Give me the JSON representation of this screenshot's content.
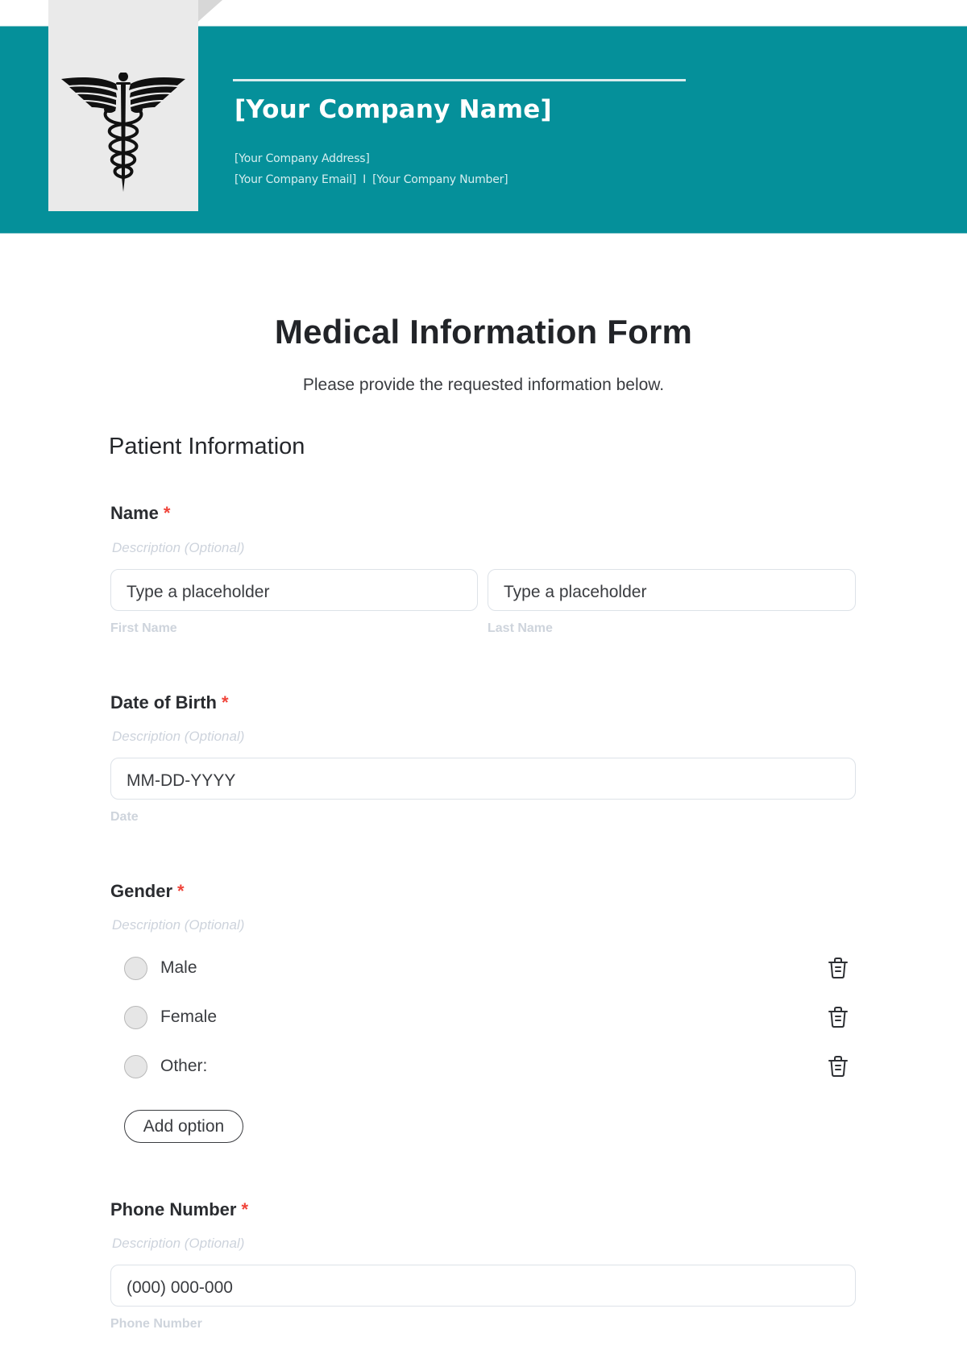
{
  "header": {
    "company_name": "[Your Company Name]",
    "company_address": "[Your Company Address]",
    "company_email": "[Your Company Email]",
    "separator": "I",
    "company_number": "[Your Company Number]",
    "logo_icon": "caduceus-icon",
    "brand_color": "#05909a"
  },
  "form": {
    "title": "Medical Information Form",
    "subtitle": "Please provide the requested information below.",
    "section_heading": "Patient Information",
    "required_marker": "*",
    "fields": {
      "name": {
        "label": "Name",
        "description": "Description (Optional)",
        "first": {
          "placeholder": "Type a placeholder",
          "helper": "First Name"
        },
        "last": {
          "placeholder": "Type a placeholder",
          "helper": "Last Name"
        }
      },
      "dob": {
        "label": "Date of Birth",
        "description": "Description (Optional)",
        "placeholder": "MM-DD-YYYY",
        "helper": "Date"
      },
      "gender": {
        "label": "Gender",
        "description": "Description (Optional)",
        "options": [
          {
            "label": "Male",
            "delete_icon": "trash-icon"
          },
          {
            "label": "Female",
            "delete_icon": "trash-icon"
          },
          {
            "label": "Other:",
            "delete_icon": "trash-icon"
          }
        ],
        "add_option_label": "Add option"
      },
      "phone": {
        "label": "Phone Number",
        "description": "Description (Optional)",
        "placeholder": "(000) 000-000",
        "helper": "Phone Number"
      }
    }
  }
}
